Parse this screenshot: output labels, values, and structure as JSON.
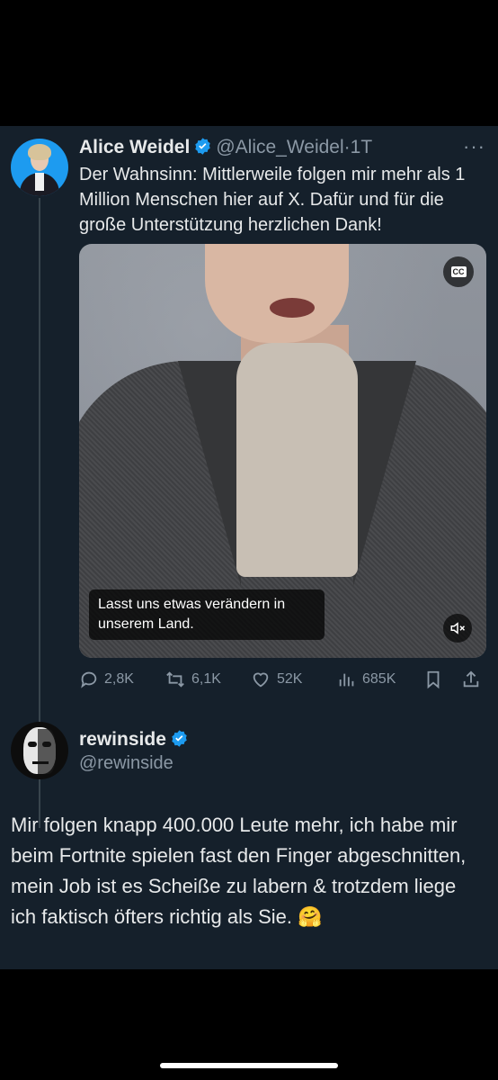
{
  "tweet": {
    "author_name": "Alice Weidel",
    "author_handle": "@Alice_Weidel",
    "separator": "·",
    "age": "1T",
    "more_icon": "···",
    "text": "Der Wahnsinn: Mittlerweile folgen mir mehr als 1 Million Menschen hier auf X. Dafür und für die große Unterstützung herzlichen Dank!",
    "video": {
      "caption": "Lasst uns etwas verändern in unserem Land.",
      "cc_label": "CC"
    },
    "actions": {
      "replies": "2,8K",
      "reposts": "6,1K",
      "likes": "52K",
      "views": "685K"
    }
  },
  "reply": {
    "author_name": "rewinside",
    "author_handle": "@rewinside",
    "text": "Mir folgen knapp 400.000 Leute mehr, ich habe mir beim Fortnite spielen fast den Finger abgeschnitten, mein Job ist es Scheiße zu labern & trotzdem liege ich faktisch öfters richtig als Sie. 🤗"
  },
  "colors": {
    "background": "#000000",
    "card": "#15202b",
    "text": "#e7e9ea",
    "muted": "#8b98a5",
    "verified": "#1d9bf0"
  }
}
